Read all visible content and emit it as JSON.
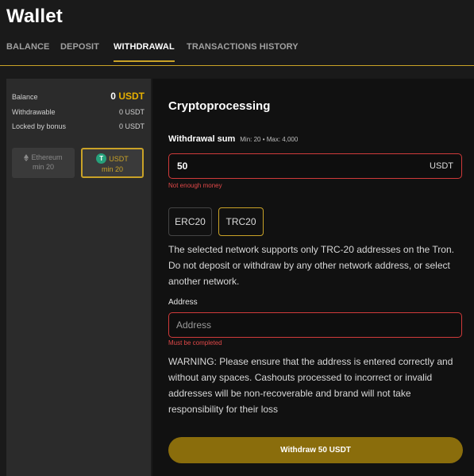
{
  "page": {
    "title": "Wallet"
  },
  "tabs": [
    {
      "label": "BALANCE",
      "active": false
    },
    {
      "label": "DEPOSIT",
      "active": false
    },
    {
      "label": "WITHDRAWAL",
      "active": true
    },
    {
      "label": "TRANSACTIONS HISTORY",
      "active": false
    }
  ],
  "sidebar": {
    "balance_label": "Balance",
    "balance_amount": "0",
    "balance_currency": "USDT",
    "withdrawable_label": "Withdrawable",
    "withdrawable_value": "0 USDT",
    "locked_label": "Locked by bonus",
    "locked_value": "0 USDT",
    "coins": [
      {
        "name": "Ethereum",
        "min": "min 20",
        "icon": "ethereum-icon",
        "active": false
      },
      {
        "name": "USDT",
        "min": "min 20",
        "icon": "tether-icon",
        "active": true
      }
    ]
  },
  "main": {
    "heading": "Cryptoprocessing",
    "sum_label": "Withdrawal sum",
    "sum_limits": "Min: 20 • Max: 4,000",
    "sum_value": "50",
    "sum_currency": "USDT",
    "sum_error": "Not enough money",
    "networks": [
      {
        "label": "ERC20",
        "active": false
      },
      {
        "label": "TRC20",
        "active": true
      }
    ],
    "network_note": "The selected network supports only TRC-20 addresses on the Tron. Do not deposit or withdraw by any other network address, or select another network.",
    "address_label": "Address",
    "address_placeholder": "Address",
    "address_error": "Must be completed",
    "warning": "WARNING: Please ensure that the address is entered correctly and without any spaces. Cashouts processed to incorrect or invalid addresses will be non-recoverable and brand will not take responsibility for their loss",
    "submit_label": "Withdraw 50 USDT"
  },
  "colors": {
    "accent": "#c9a227",
    "error": "#e04848",
    "button": "#8a6d0c",
    "tether": "#26a17b"
  }
}
